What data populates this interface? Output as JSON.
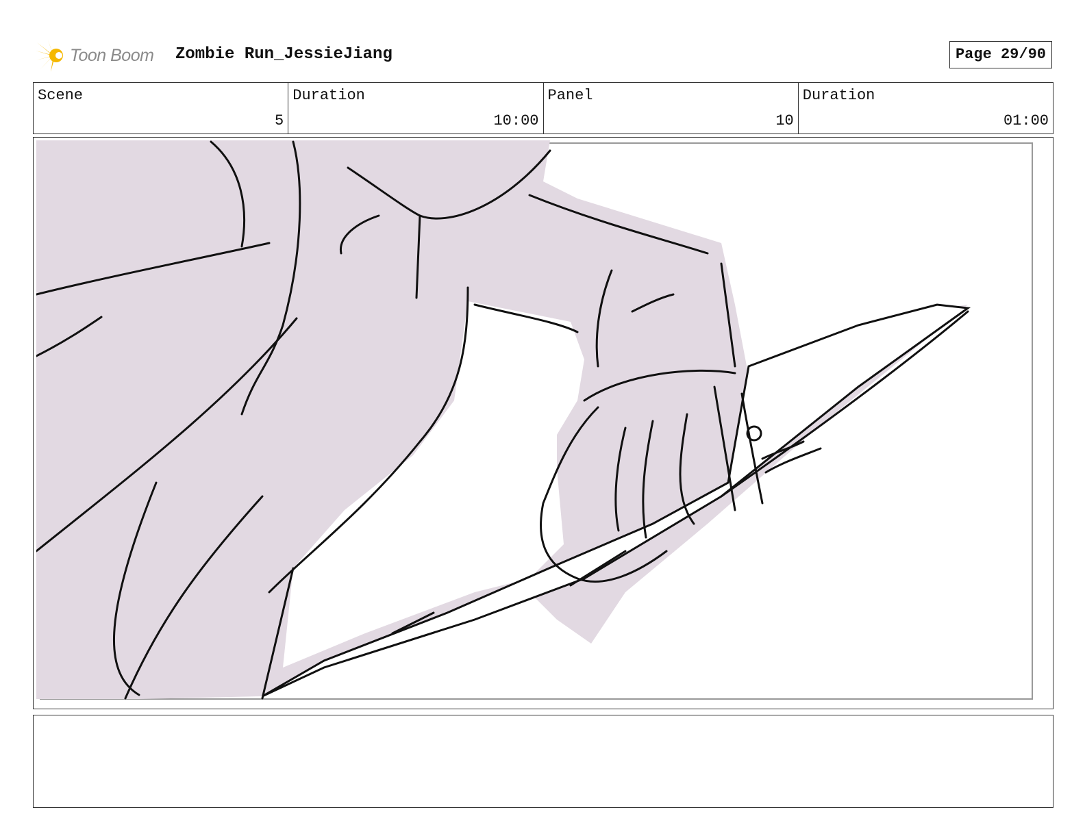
{
  "header": {
    "logo_text": "Toon Boom",
    "project_title": "Zombie Run_JessieJiang",
    "page_label": "Page 29/90"
  },
  "info": {
    "scene_label": "Scene",
    "scene_value": "5",
    "scene_duration_label": "Duration",
    "scene_duration_value": "10:00",
    "panel_label": "Panel",
    "panel_value": "10",
    "panel_duration_label": "Duration",
    "panel_duration_value": "01:00"
  },
  "colors": {
    "sketch_fill": "#e2d9e2",
    "line": "#111111",
    "border": "#333333",
    "logo_yellow": "#f5b800"
  },
  "notes": {
    "text": ""
  }
}
